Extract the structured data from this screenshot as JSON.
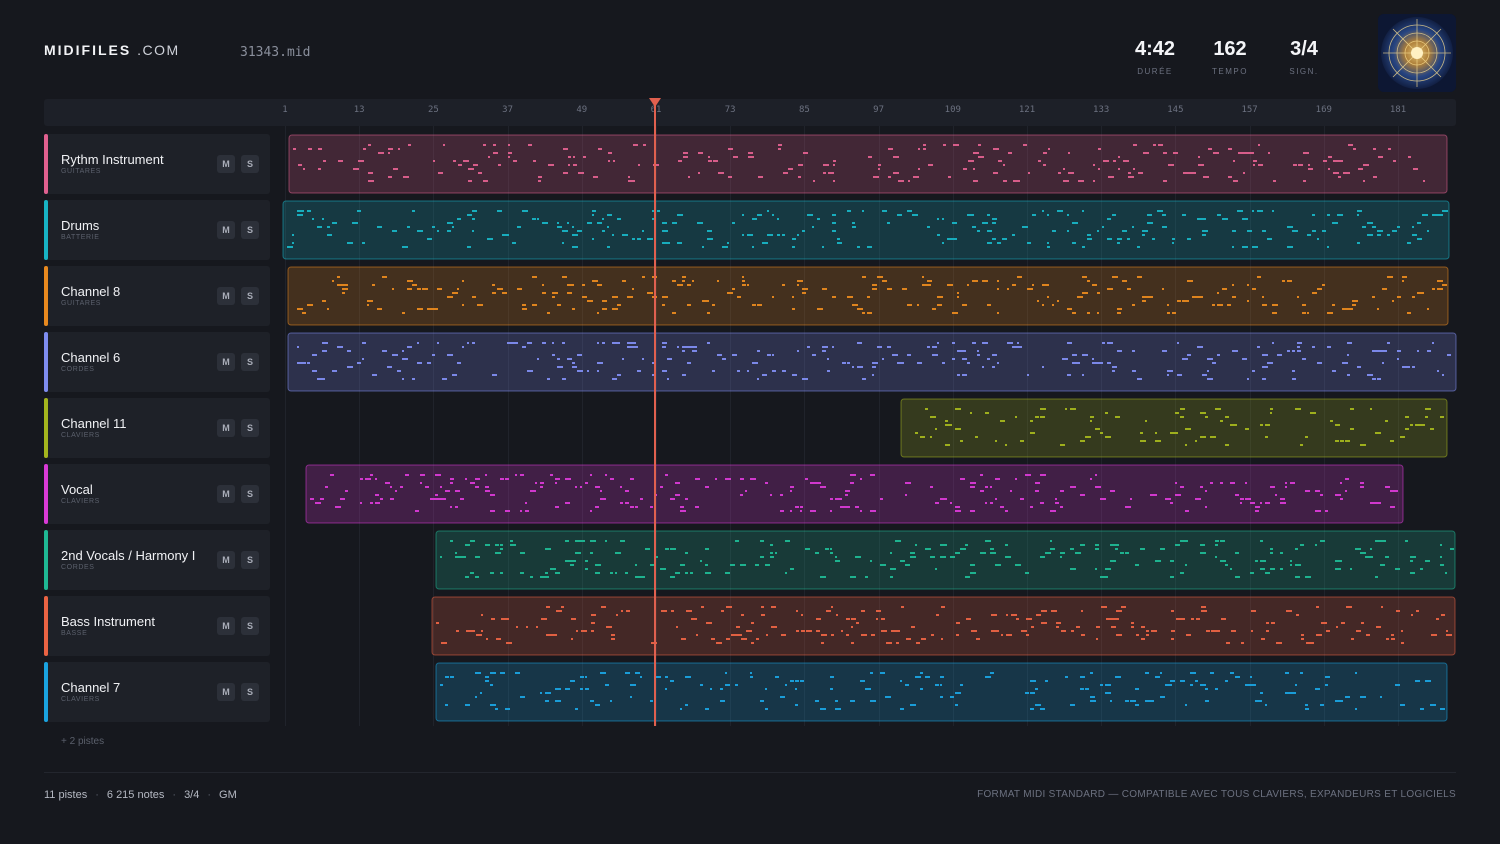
{
  "header": {
    "brand_main": "MIDIFILES",
    "brand_suffix": ".COM",
    "filename": "31343.mid",
    "stats": [
      {
        "value": "4:42",
        "label": "DURÉE"
      },
      {
        "value": "162",
        "label": "TEMPO"
      },
      {
        "value": "3/4",
        "label": "SIGN."
      }
    ],
    "cover_icon": "album-cover-mandala"
  },
  "ruler": {
    "ticks": [
      "1",
      "13",
      "25",
      "37",
      "49",
      "61",
      "73",
      "85",
      "97",
      "109",
      "121",
      "133",
      "145",
      "157",
      "169",
      "181"
    ]
  },
  "tracks": [
    {
      "name": "Rythm Instrument",
      "category": "GUITARES",
      "color": "#e0608f",
      "mute": "M",
      "solo": "S"
    },
    {
      "name": "Drums",
      "category": "BATTERIE",
      "color": "#18b3c4",
      "mute": "M",
      "solo": "S"
    },
    {
      "name": "Channel 8",
      "category": "GUITARES",
      "color": "#e8891f",
      "mute": "M",
      "solo": "S"
    },
    {
      "name": "Channel 6",
      "category": "CORDES",
      "color": "#7f8df0",
      "mute": "M",
      "solo": "S"
    },
    {
      "name": "Channel 11",
      "category": "CLAVIERS",
      "color": "#a4b51e",
      "mute": "M",
      "solo": "S"
    },
    {
      "name": "Vocal",
      "category": "CLAVIERS",
      "color": "#d93ad6",
      "mute": "M",
      "solo": "S"
    },
    {
      "name": "2nd Vocals / Harmony I",
      "category": "CORDES",
      "color": "#1fb894",
      "mute": "M",
      "solo": "S"
    },
    {
      "name": "Bass Instrument",
      "category": "BASSE",
      "color": "#ea6343",
      "mute": "M",
      "solo": "S"
    },
    {
      "name": "Channel 7",
      "category": "CLAVIERS",
      "color": "#1aa3e0",
      "mute": "M",
      "solo": "S"
    }
  ],
  "more_tracks": "+ 2 pistes",
  "footer": {
    "tracks_count": "11 pistes",
    "notes_count": "6 215 notes",
    "signature": "3/4",
    "standard": "GM",
    "tagline": "FORMAT MIDI STANDARD — COMPATIBLE AVEC TOUS CLAVIERS, EXPANDEURS ET LOGICIELS"
  }
}
